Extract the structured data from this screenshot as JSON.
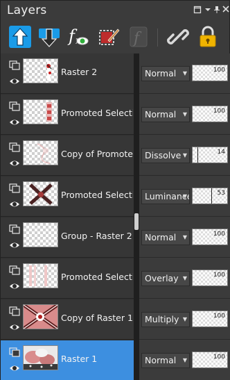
{
  "panel": {
    "title": "Layers",
    "window_controls": [
      "restore-icon",
      "dropdown-icon",
      "pin-icon",
      "close-icon"
    ]
  },
  "toolbar": {
    "tools": [
      {
        "name": "move-layer-up-icon"
      },
      {
        "name": "move-layer-down-icon"
      },
      {
        "name": "fx-effects-icon"
      },
      {
        "name": "edit-selection-icon"
      },
      {
        "name": "script-icon"
      },
      {
        "name": "link-icon"
      },
      {
        "name": "lock-icon"
      }
    ]
  },
  "layers": [
    {
      "name": "Raster 2",
      "blend": "Normal",
      "opacity": 100,
      "thumb": "raster2",
      "selected": false
    },
    {
      "name": "Promoted Selection",
      "blend": "Normal",
      "opacity": 100,
      "thumb": "promoted1",
      "selected": false
    },
    {
      "name": "Copy of Promoted",
      "blend": "Dissolve",
      "opacity": 14,
      "thumb": "copypromoted",
      "selected": false
    },
    {
      "name": "Promoted Selection",
      "blend": "Luminance (L)",
      "opacity": 53,
      "thumb": "promoted2",
      "selected": false
    },
    {
      "name": "Group - Raster 2",
      "blend": "Normal",
      "opacity": 100,
      "thumb": "group",
      "selected": false
    },
    {
      "name": "Promoted Selection",
      "blend": "Overlay",
      "opacity": 100,
      "thumb": "promoted3",
      "selected": false
    },
    {
      "name": "Copy of Raster 1",
      "blend": "Multiply",
      "opacity": 100,
      "thumb": "copyraster1",
      "selected": false
    },
    {
      "name": "Raster 1",
      "blend": "Normal",
      "opacity": 100,
      "thumb": "raster1",
      "selected": true
    }
  ],
  "colors": {
    "selected": "#3d8fe0",
    "panel": "#3b3b3b",
    "list_left": "#363636",
    "accent_blue": "#1a9be8",
    "lock_yellow": "#f0b400"
  }
}
